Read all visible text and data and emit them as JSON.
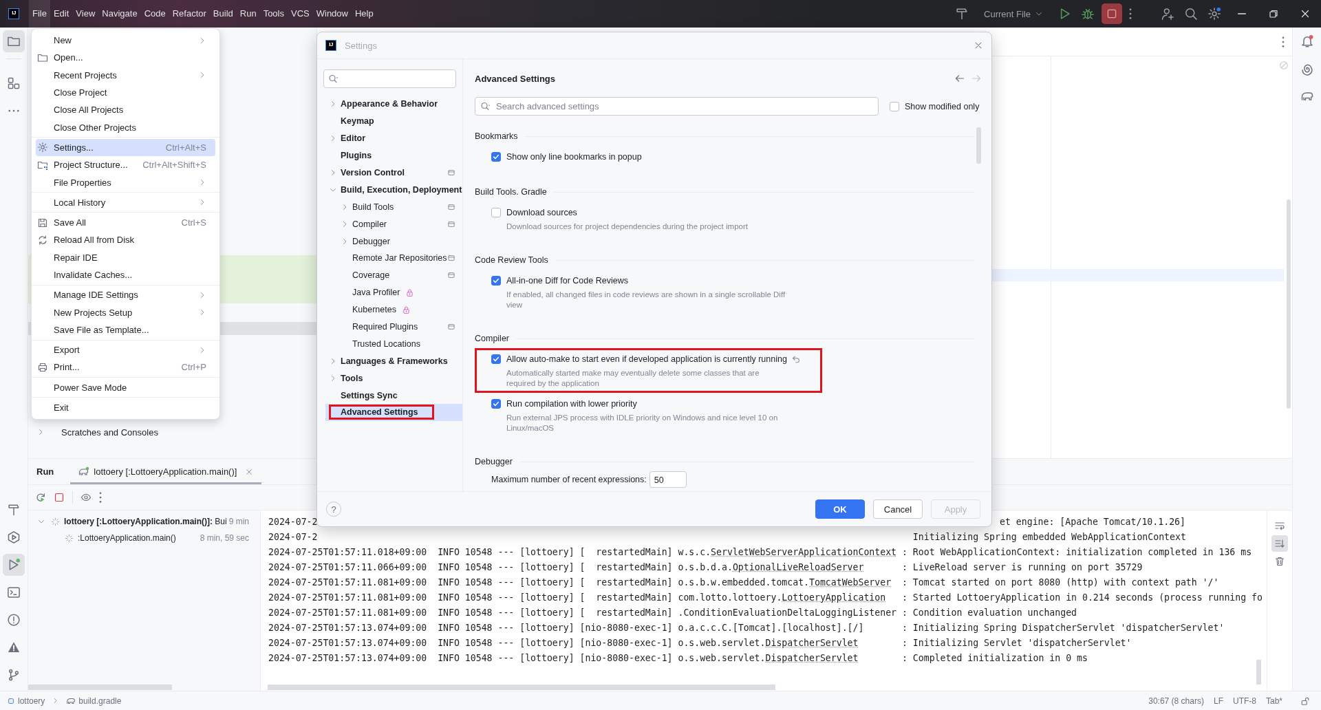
{
  "title_bar": {
    "logo": "IJ",
    "menu": [
      {
        "label": "File",
        "selected": true
      },
      {
        "label": "Edit",
        "selected": false
      },
      {
        "label": "View",
        "selected": false
      },
      {
        "label": "Navigate",
        "selected": false
      },
      {
        "label": "Code",
        "selected": false
      },
      {
        "label": "Refactor",
        "selected": false
      },
      {
        "label": "Build",
        "selected": false
      },
      {
        "label": "Run",
        "selected": false
      },
      {
        "label": "Tools",
        "selected": false
      },
      {
        "label": "VCS",
        "selected": false
      },
      {
        "label": "Window",
        "selected": false
      },
      {
        "label": "Help",
        "selected": false
      }
    ],
    "run_config": "Current File"
  },
  "tool_strip_top": [
    {
      "selected": true
    },
    {
      "selected": false
    },
    {
      "selected": false
    }
  ],
  "tool_strip_bottom": [
    {
      "selected": false
    },
    {
      "selected": false
    },
    {
      "selected": true
    },
    {
      "selected": false
    },
    {
      "selected": false
    },
    {
      "selected": false
    },
    {
      "selected": false
    }
  ],
  "project_tree": [
    {
      "label": "Scratches and Consoles",
      "expanded": false
    }
  ],
  "file_menu": [
    {
      "kind": "item",
      "label": "New",
      "submenu": true,
      "selected": false
    },
    {
      "kind": "item",
      "label": "Open...",
      "submenu": false,
      "selected": false
    },
    {
      "kind": "item",
      "label": "Recent Projects",
      "submenu": true,
      "selected": false
    },
    {
      "kind": "item",
      "label": "Close Project",
      "submenu": false,
      "selected": false
    },
    {
      "kind": "item",
      "label": "Close All Projects",
      "submenu": false,
      "selected": false
    },
    {
      "kind": "item",
      "label": "Close Other Projects",
      "submenu": false,
      "selected": false
    },
    {
      "kind": "separator"
    },
    {
      "kind": "item",
      "label": "Settings...",
      "shortcut": "Ctrl+Alt+S",
      "submenu": false,
      "selected": true
    },
    {
      "kind": "item",
      "label": "Project Structure...",
      "shortcut": "Ctrl+Alt+Shift+S",
      "submenu": false,
      "selected": false
    },
    {
      "kind": "item",
      "label": "File Properties",
      "submenu": true,
      "selected": false
    },
    {
      "kind": "separator"
    },
    {
      "kind": "item",
      "label": "Local History",
      "submenu": true,
      "selected": false
    },
    {
      "kind": "separator"
    },
    {
      "kind": "item",
      "label": "Save All",
      "shortcut": "Ctrl+S",
      "submenu": false,
      "selected": false
    },
    {
      "kind": "item",
      "label": "Reload All from Disk",
      "submenu": false,
      "selected": false
    },
    {
      "kind": "item",
      "label": "Repair IDE",
      "submenu": false,
      "selected": false
    },
    {
      "kind": "item",
      "label": "Invalidate Caches...",
      "submenu": false,
      "selected": false
    },
    {
      "kind": "separator"
    },
    {
      "kind": "item",
      "label": "Manage IDE Settings",
      "submenu": true,
      "selected": false
    },
    {
      "kind": "item",
      "label": "New Projects Setup",
      "submenu": true,
      "selected": false
    },
    {
      "kind": "item",
      "label": "Save File as Template...",
      "submenu": false,
      "selected": false
    },
    {
      "kind": "separator"
    },
    {
      "kind": "item",
      "label": "Export",
      "submenu": true,
      "selected": false
    },
    {
      "kind": "item",
      "label": "Print...",
      "shortcut": "Ctrl+P",
      "submenu": false,
      "selected": false
    },
    {
      "kind": "separator"
    },
    {
      "kind": "item",
      "label": "Power Save Mode",
      "submenu": false,
      "selected": false
    },
    {
      "kind": "separator"
    },
    {
      "kind": "item",
      "label": "Exit",
      "submenu": false,
      "selected": false
    }
  ],
  "settings_dialog": {
    "logo": "IJ",
    "title": "Settings",
    "tree": [
      {
        "label": "Appearance & Behavior",
        "expanded": false,
        "project": false,
        "locked": false,
        "selected": false,
        "highlighted": false
      },
      {
        "label": "Keymap",
        "project": false,
        "locked": false,
        "selected": false,
        "highlighted": false
      },
      {
        "label": "Editor",
        "expanded": false,
        "project": false,
        "locked": false,
        "selected": false,
        "highlighted": false
      },
      {
        "label": "Plugins",
        "project": false,
        "locked": false,
        "selected": false,
        "highlighted": false
      },
      {
        "label": "Version Control",
        "expanded": false,
        "project": true,
        "locked": false,
        "selected": false,
        "highlighted": false
      },
      {
        "label": "Build, Execution, Deployment",
        "expanded": true,
        "project": false,
        "locked": false,
        "selected": false,
        "highlighted": false,
        "children": [
          {
            "label": "Build Tools",
            "expanded": false,
            "project": true,
            "locked": false,
            "selected": false,
            "highlighted": false
          },
          {
            "label": "Compiler",
            "expanded": false,
            "project": true,
            "locked": false,
            "selected": false,
            "highlighted": false
          },
          {
            "label": "Debugger",
            "expanded": false,
            "project": false,
            "locked": false,
            "selected": false,
            "highlighted": false
          },
          {
            "label": "Remote Jar Repositories",
            "project": true,
            "locked": false,
            "selected": false,
            "highlighted": false
          },
          {
            "label": "Coverage",
            "project": true,
            "locked": false,
            "selected": false,
            "highlighted": false
          },
          {
            "label": "Java Profiler",
            "project": false,
            "locked": true,
            "selected": false,
            "highlighted": false
          },
          {
            "label": "Kubernetes",
            "project": false,
            "locked": true,
            "selected": false,
            "highlighted": false
          },
          {
            "label": "Required Plugins",
            "project": true,
            "locked": false,
            "selected": false,
            "highlighted": false
          },
          {
            "label": "Trusted Locations",
            "project": false,
            "locked": false,
            "selected": false,
            "highlighted": false
          }
        ]
      },
      {
        "label": "Languages & Frameworks",
        "expanded": false,
        "project": false,
        "locked": false,
        "selected": false,
        "highlighted": false
      },
      {
        "label": "Tools",
        "expanded": false,
        "project": false,
        "locked": false,
        "selected": false,
        "highlighted": false
      },
      {
        "label": "Settings Sync",
        "project": false,
        "locked": false,
        "selected": false,
        "highlighted": false
      },
      {
        "label": "Advanced Settings",
        "project": false,
        "locked": false,
        "selected": true,
        "highlighted": true
      }
    ],
    "heading": "Advanced Settings",
    "search_placeholder": "Search advanced settings",
    "show_modified_only": {
      "label": "Show modified only",
      "checked": false
    },
    "sections": [
      {
        "title": "Bookmarks",
        "options": [
          {
            "kind": "checkbox",
            "label": "Show only line bookmarks in popup",
            "checked": true
          }
        ]
      },
      {
        "title": "Build Tools. Gradle",
        "options": [
          {
            "kind": "checkbox",
            "label": "Download sources",
            "description": "Download sources for project dependencies during the project import",
            "checked": false
          }
        ]
      },
      {
        "title": "Code Review Tools",
        "options": [
          {
            "kind": "checkbox",
            "label": "All-in-one Diff for Code Reviews",
            "description": "If enabled, all changed files in code reviews are shown in a single scrollable Diff view",
            "checked": true
          }
        ]
      },
      {
        "title": "Compiler",
        "options": [
          {
            "kind": "checkbox",
            "label": "Allow auto-make to start even if developed application is currently running",
            "description": "Automatically started make may eventually delete some classes that are required by the application",
            "checked": true,
            "modified": true,
            "highlighted": true
          },
          {
            "kind": "checkbox",
            "label": "Run compilation with lower priority",
            "description": "Run external JPS process with IDLE priority on Windows and nice level 10 on Linux/macOS",
            "checked": true
          }
        ]
      },
      {
        "title": "Debugger",
        "options": [
          {
            "kind": "number",
            "label": "Maximum number of recent expressions:",
            "value": "50"
          }
        ]
      }
    ],
    "help": "?",
    "buttons": [
      {
        "label": "OK",
        "kind": "primary"
      },
      {
        "label": "Cancel",
        "kind": "secondary"
      },
      {
        "label": "Apply",
        "kind": "disabled"
      }
    ]
  },
  "run_panel": {
    "title": "Run",
    "tabs": [
      {
        "label": "lottoery [:LottoeryApplication.main()]",
        "selected": true
      }
    ],
    "tree": [
      {
        "label": "**lottoery [:LottoeryApplication.main()]:** Bui",
        "time": "9 min",
        "expanded": true,
        "children": [
          {
            "label": ":LottoeryApplication.main()",
            "time": "8 min, 59 sec"
          }
        ]
      }
    ],
    "console": [
      {
        "kind": "covered",
        "start": "2024-07-2",
        "end": "et engine: [Apache Tomcat/10.1.26]"
      },
      {
        "kind": "covered",
        "start": "2024-07-2",
        "end": "Initializing Spring embedded WebApplicationContext"
      },
      {
        "kind": "full",
        "prefix": "2024-07-25T01:57:11.018+09:00  INFO 10548 --- [lottoery] [  restartedMain] ",
        "logger": "w.s.c.",
        "logger_class": "ServletWebServerApplicationContext",
        "message": ": Root WebApplicationContext: initialization completed in 136 ms"
      },
      {
        "kind": "full",
        "prefix": "2024-07-25T01:57:11.066+09:00  INFO 10548 --- [lottoery] [  restartedMain] ",
        "logger": "o.s.b.d.a.",
        "logger_class": "OptionalLiveReloadServer",
        "message": ": LiveReload server is running on port 35729"
      },
      {
        "kind": "full",
        "prefix": "2024-07-25T01:57:11.081+09:00  INFO 10548 --- [lottoery] [  restartedMain] ",
        "logger": "o.s.b.w.embedded.tomcat.",
        "logger_class": "TomcatWebServer",
        "message": ": Tomcat started on port 8080 (http) with context path '/'"
      },
      {
        "kind": "full",
        "prefix": "2024-07-25T01:57:11.081+09:00  INFO 10548 --- [lottoery] [  restartedMain] ",
        "logger": "com.lotto.lottoery.",
        "logger_class": "LottoeryApplication",
        "message": ": Started LottoeryApplication in 0.214 seconds (process running fo"
      },
      {
        "kind": "full",
        "prefix": "2024-07-25T01:57:11.081+09:00  INFO 10548 --- [lottoery] [  restartedMain] ",
        "logger": ".ConditionEvaluationDeltaLoggingListener",
        "message": ": Condition evaluation unchanged"
      },
      {
        "kind": "full",
        "prefix": "2024-07-25T01:57:13.074+09:00  INFO 10548 --- [lottoery] [nio-8080-exec-1] ",
        "logger": "o.a.c.c.C.[Tomcat].[localhost].[/]",
        "message": ": Initializing Spring DispatcherServlet 'dispatcherServlet'"
      },
      {
        "kind": "full",
        "prefix": "2024-07-25T01:57:13.074+09:00  INFO 10548 --- [lottoery] [nio-8080-exec-1] ",
        "logger": "o.s.web.servlet.",
        "logger_class": "DispatcherServlet",
        "message": ": Initializing Servlet 'dispatcherServlet'"
      },
      {
        "kind": "full",
        "prefix": "2024-07-25T01:57:13.074+09:00  INFO 10548 --- [lottoery] [nio-8080-exec-1] ",
        "logger": "o.s.web.servlet.",
        "logger_class": "DispatcherServlet",
        "message": ": Completed initialization in 0 ms"
      }
    ]
  },
  "status_bar": {
    "breadcrumbs": [
      "lottoery",
      "build.gradle"
    ],
    "items": [
      "30:67 (8 chars)",
      "LF",
      "UTF-8",
      "Tab*"
    ]
  }
}
